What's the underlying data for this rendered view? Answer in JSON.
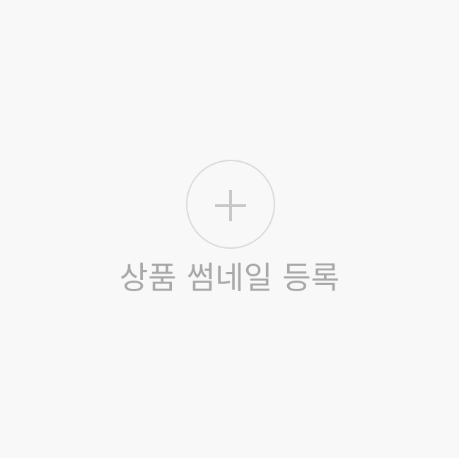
{
  "upload": {
    "label": "상품 썸네일 등록",
    "icon": "plus-icon"
  },
  "colors": {
    "background": "#f8f8f8",
    "circle_border": "#dadada",
    "plus": "#c8c8c8",
    "label_text": "#a8a8a8"
  }
}
